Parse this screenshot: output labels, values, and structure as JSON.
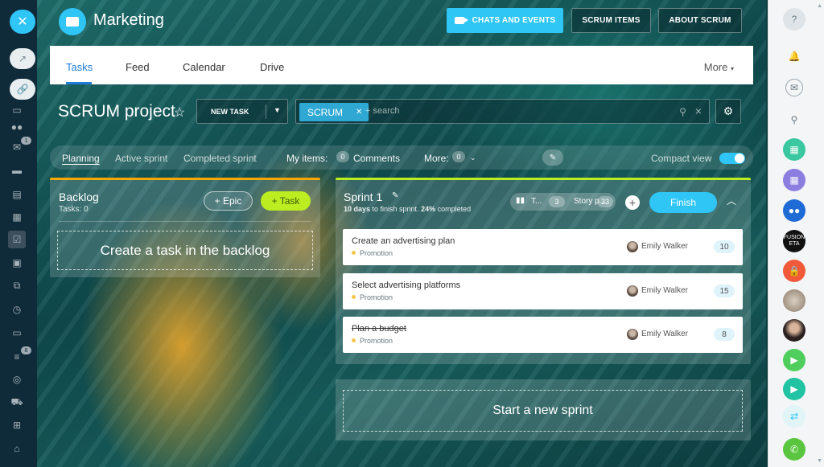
{
  "left_sidebar": {
    "icons": [
      "close-icon",
      "external-link-icon",
      "link-icon",
      "chat-icon",
      "team-icon",
      "mail-icon",
      "inbox-icon",
      "document-icon",
      "calendar-icon",
      "tasks-icon",
      "contacts-icon",
      "workflow-icon",
      "clock-icon",
      "window-icon",
      "filter-icon",
      "target-icon",
      "cart-icon",
      "apps-icon",
      "robot-icon"
    ],
    "mail_badge": "1",
    "filter_badge": "8"
  },
  "header": {
    "group_title": "Marketing",
    "chats_label": "CHATS AND EVENTS",
    "scrum_items_label": "SCRUM ITEMS",
    "about_scrum_label": "ABOUT SCRUM"
  },
  "tabs": {
    "items": [
      "Tasks",
      "Feed",
      "Calendar",
      "Drive"
    ],
    "more": "More"
  },
  "toolbar": {
    "project_title": "SCRUM project",
    "new_task_label": "NEW TASK",
    "filter_chip": "SCRUM",
    "search_placeholder": "+ search"
  },
  "filters": {
    "planning": "Planning",
    "active_sprint": "Active sprint",
    "completed_sprint": "Completed sprint",
    "my_items": "My items:",
    "comments_count": "0",
    "comments": "Comments",
    "more": "More:",
    "more_count": "0",
    "compact_view": "Compact view"
  },
  "backlog": {
    "title": "Backlog",
    "tasks_count": "Tasks: 0",
    "epic_label": "+ Epic",
    "task_label": "+ Task",
    "create_label": "Create a task in the backlog"
  },
  "sprint": {
    "title": "Sprint 1",
    "days_left": "10 days",
    "days_text": " to finish sprint. ",
    "completed_pct": "24%",
    "completed_text": " completed",
    "tasks_short": "T...",
    "tasks_count": "3",
    "story_points_short": "Story p...",
    "story_points": "33",
    "finish_label": "Finish",
    "tasks": [
      {
        "title": "Create an advertising plan",
        "tag": "Promotion",
        "user": "Emily Walker",
        "points": "10"
      },
      {
        "title": "Select advertising platforms",
        "tag": "Promotion",
        "user": "Emily Walker",
        "points": "15"
      },
      {
        "title": "Plan a budget",
        "tag": "Promotion",
        "user": "Emily Walker",
        "points": "8"
      }
    ]
  },
  "new_sprint_label": "Start a new sprint",
  "right_sidebar": {
    "items": [
      "help-icon",
      "bell-icon",
      "chat-icon",
      "search-icon",
      "calendar-green-icon",
      "calendar-purple-icon",
      "group-chat-icon",
      "fusion-avatar",
      "lock-icon",
      "avatar-1",
      "avatar-2",
      "video-call-icon",
      "video-call-icon-2",
      "transfer-icon",
      "phone-icon"
    ],
    "fusion_label": "FUSION ETA"
  },
  "colors": {
    "accent": "#2fc6f6",
    "backlog_border": "#f7a700",
    "sprint_border": "#bbed21",
    "task_button": "#bbed21",
    "active_tab": "#1f7bd7"
  }
}
